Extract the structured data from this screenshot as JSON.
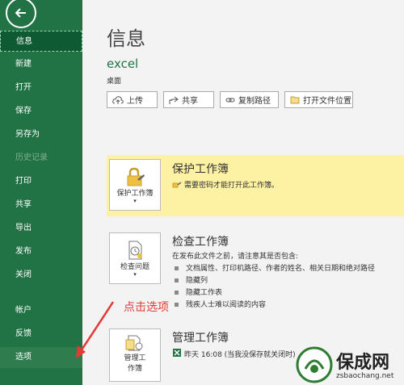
{
  "sidebar": {
    "items": [
      {
        "label": "信息"
      },
      {
        "label": "新建"
      },
      {
        "label": "打开"
      },
      {
        "label": "保存"
      },
      {
        "label": "另存为"
      },
      {
        "label": "历史记录"
      },
      {
        "label": "打印"
      },
      {
        "label": "共享"
      },
      {
        "label": "导出"
      },
      {
        "label": "发布"
      },
      {
        "label": "关闭"
      },
      {
        "label": "帐户"
      },
      {
        "label": "反馈"
      },
      {
        "label": "选项"
      }
    ]
  },
  "main": {
    "title": "信息",
    "file_name": "excel",
    "file_location": "桌面",
    "buttons": [
      {
        "label": "上传"
      },
      {
        "label": "共享"
      },
      {
        "label": "复制路径"
      },
      {
        "label": "打开文件位置"
      }
    ]
  },
  "protect": {
    "button_label": "保护工作簿",
    "title": "保护工作簿",
    "desc": "需要密码才能打开此工作簿。"
  },
  "inspect": {
    "button_label": "检查问题",
    "title": "检查工作簿",
    "desc": "在发布此文件之前，请注意其是否包含:",
    "bullets": [
      "文档属性、打印机路径、作者的姓名、相关日期和绝对路径",
      "隐藏列",
      "隐藏工作表",
      "残疾人士难以阅读的内容"
    ]
  },
  "manage": {
    "button_label_1": "管理工",
    "button_label_2": "作簿",
    "title": "管理工作簿",
    "desc": "昨天 16:08 (当我没保存就关闭时)"
  },
  "annotation": "点击选项",
  "watermark": {
    "text": "保成网",
    "url": "zsbaochang.net"
  },
  "colors": {
    "sidebar": "#217346",
    "highlight": "#fdf2a4",
    "annotation": "#e53935"
  }
}
